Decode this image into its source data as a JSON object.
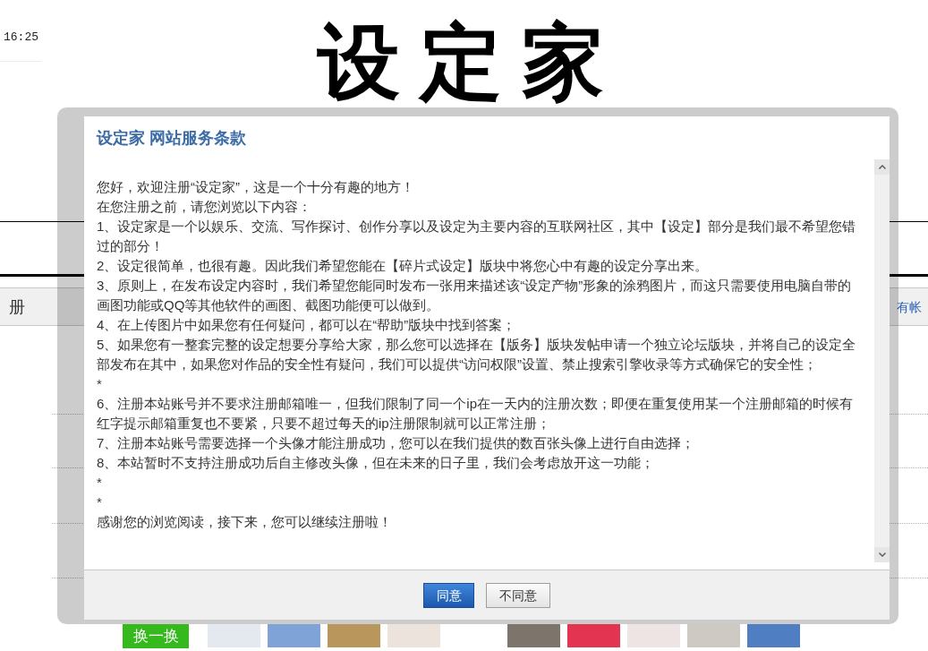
{
  "status": {
    "time": "16:25"
  },
  "logo": {
    "text": "设定家"
  },
  "nav_bar": {
    "heading": "册",
    "link": "有帐"
  },
  "avatar_picker": {
    "shuffle_button": "换一换"
  },
  "dialog": {
    "title": "设定家 网站服务条款",
    "paragraphs": [
      "您好，欢迎注册“设定家”，这是一个十分有趣的地方！",
      "在您注册之前，请您浏览以下内容：",
      "1、设定家是一个以娱乐、交流、写作探讨、创作分享以及设定为主要内容的互联网社区，其中【设定】部分是我们最不希望您错过的部分！",
      "2、设定很简单，也很有趣。因此我们希望您能在【碎片式设定】版块中将您心中有趣的设定分享出来。",
      "3、原则上，在发布设定内容时，我们希望您能同时发布一张用来描述该“设定产物”形象的涂鸦图片，而这只需要使用电脑自带的画图功能或QQ等其他软件的画图、截图功能便可以做到。",
      "4、在上传图片中如果您有任何疑问，都可以在“帮助”版块中找到答案；",
      "5、如果您有一整套完整的设定想要分享给大家，那么您可以选择在【版务】版块发帖申请一个独立论坛版块，并将自己的设定全部发布在其中，如果您对作品的安全性有疑问，我们可以提供“访问权限”设置、禁止搜索引擎收录等方式确保它的安全性；",
      "*",
      "6、注册本站账号并不要求注册邮箱唯一，但我们限制了同一个ip在一天内的注册次数；即便在重复使用某一个注册邮箱的时候有红字提示邮箱重复也不要紧，只要不超过每天的ip注册限制就可以正常注册；",
      "7、注册本站账号需要选择一个头像才能注册成功，您可以在我们提供的数百张头像上进行自由选择；",
      "8、本站暂时不支持注册成功后自主修改头像，但在未来的日子里，我们会考虑放开这一功能；",
      "*",
      "*",
      "感谢您的浏览阅读，接下来，您可以继续注册啦！"
    ],
    "buttons": [
      {
        "label": "同意",
        "kind": "primary"
      },
      {
        "label": "不同意",
        "kind": "secondary"
      }
    ]
  }
}
